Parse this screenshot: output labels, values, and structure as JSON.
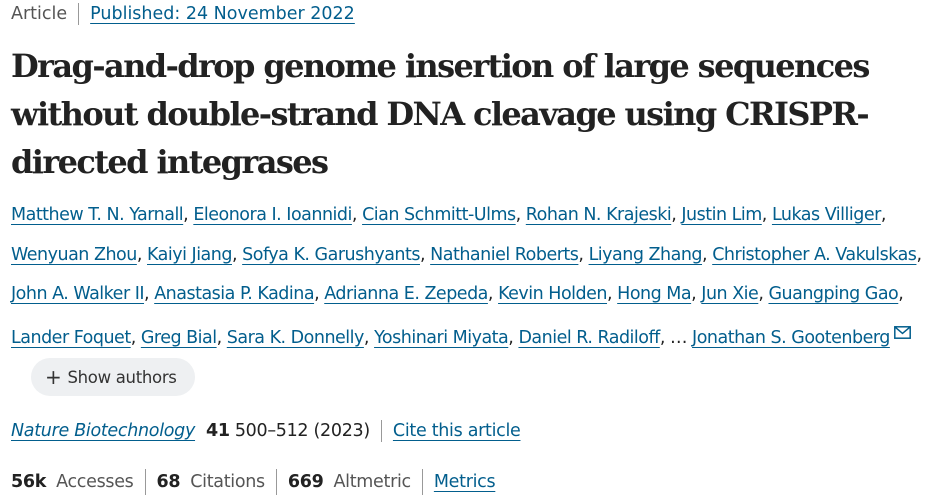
{
  "article": {
    "type_label": "Article",
    "published_label": "Published: 24 November 2022"
  },
  "title": "Drag-and-drop genome insertion of large sequences without double-strand DNA cleavage using CRISPR-directed integrases",
  "authors": [
    "Matthew T. N. Yarnall",
    "Eleonora I. Ioannidi",
    "Cian Schmitt-Ulms",
    "Rohan N. Krajeski",
    "Justin Lim",
    "Lukas Villiger",
    "Wenyuan Zhou",
    "Kaiyi Jiang",
    "Sofya K. Garushyants",
    "Nathaniel Roberts",
    "Liyang Zhang",
    "Christopher A. Vakulskas",
    "John A. Walker II",
    "Anastasia P. Kadina",
    "Adrianna E. Zepeda",
    "Kevin Holden",
    "Hong Ma",
    "Jun Xie",
    "Guangping Gao",
    "Lander Foquet",
    "Greg Bial",
    "Sara K. Donnelly",
    "Yoshinari Miyata",
    "Daniel R. Radiloff"
  ],
  "authors_ellipsis": "…",
  "last_author": "Jonathan S. Gootenberg",
  "last_author_icon": "envelope-icon",
  "show_authors": {
    "icon": "plus-icon",
    "label": "Show authors"
  },
  "citation": {
    "journal": "Nature Biotechnology",
    "volume": "41",
    "pages_year": "500–512 (2023)",
    "cite_label": "Cite this article"
  },
  "metrics": {
    "accesses_value": "56k",
    "accesses_label": "Accesses",
    "citations_value": "68",
    "citations_label": "Citations",
    "altmetric_value": "669",
    "altmetric_label": "Altmetric",
    "metrics_link": "Metrics"
  },
  "colors": {
    "link": "#025e8d",
    "text": "#222222",
    "muted": "#555555",
    "pill_bg": "#eef0f2"
  }
}
